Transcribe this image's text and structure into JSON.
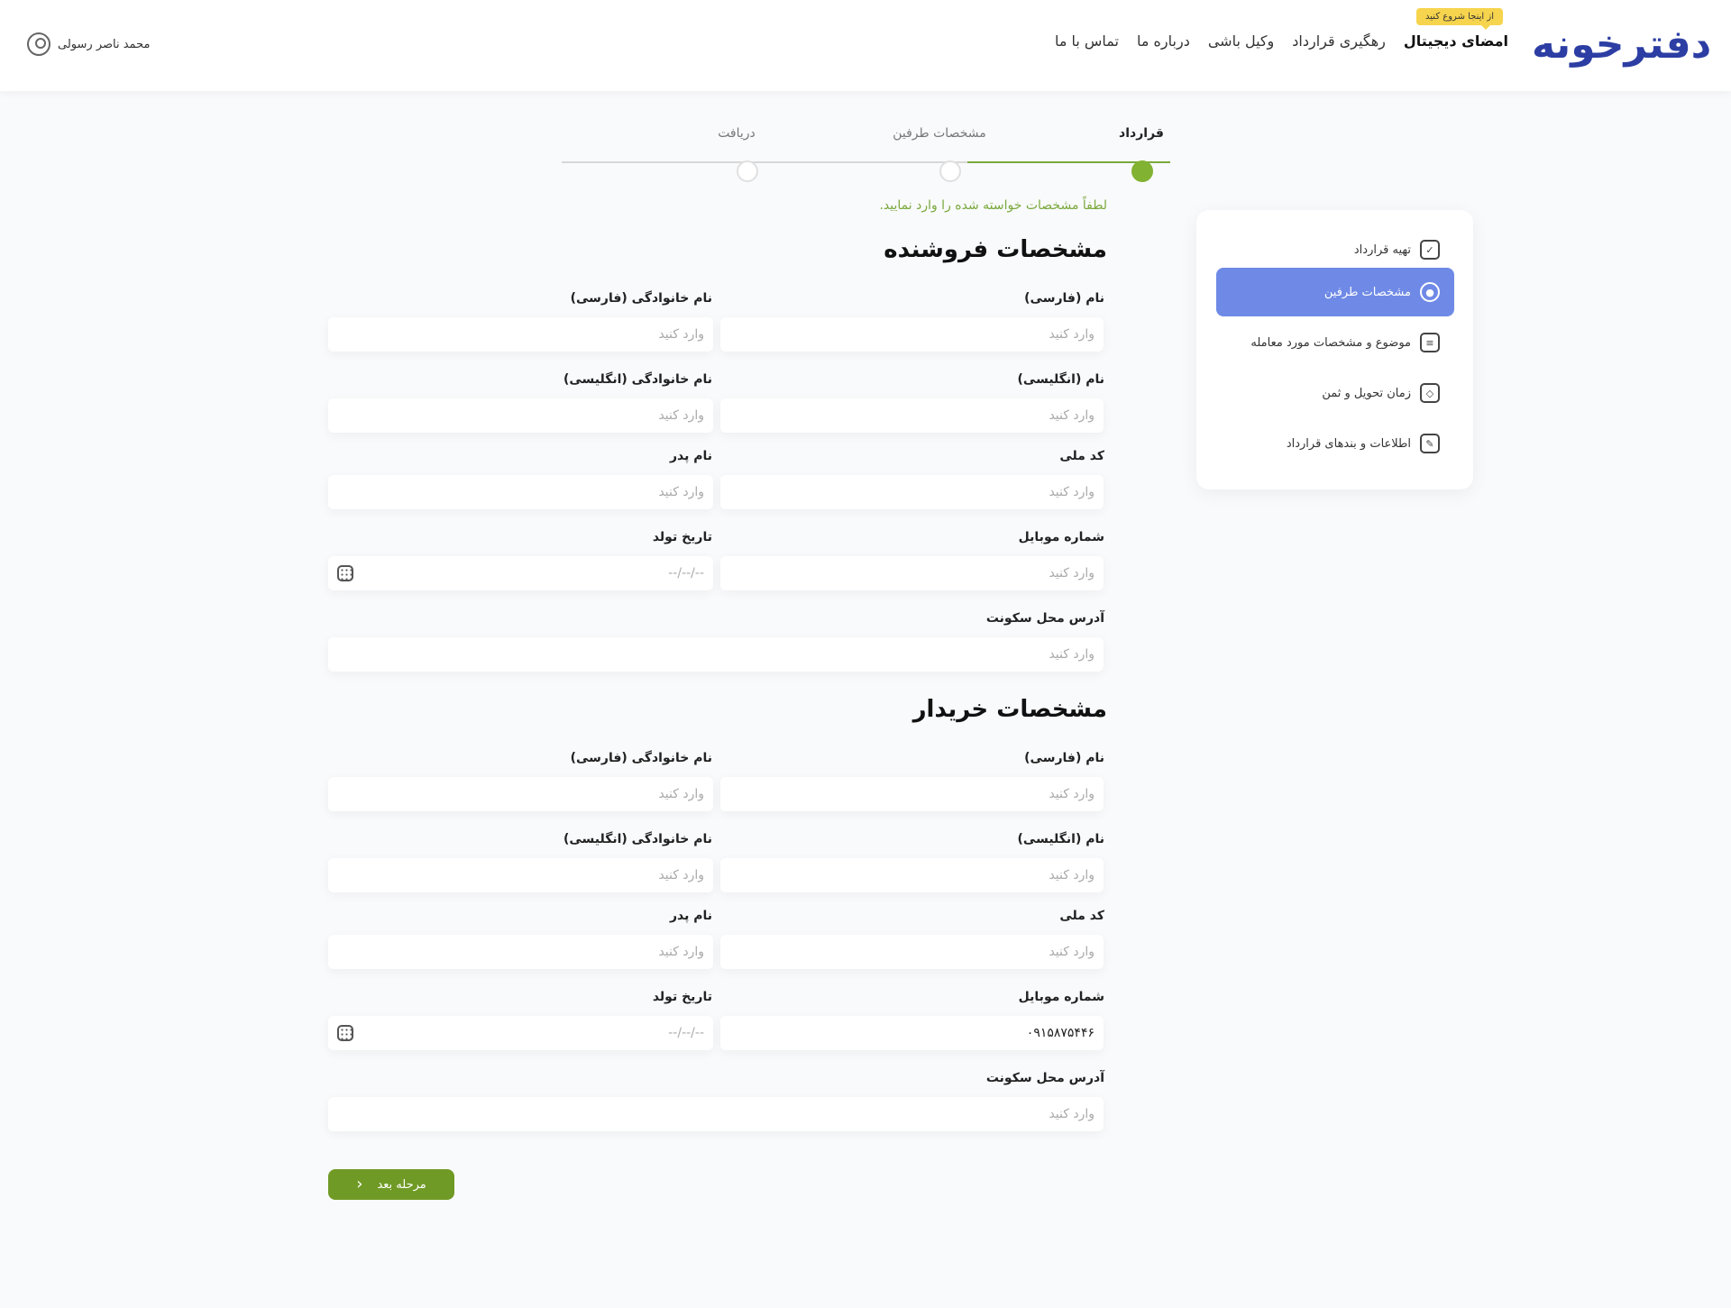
{
  "header": {
    "logo_text": "دفترخونه",
    "badge": "از اینجا شروع کنید",
    "nav": [
      "امضای دیجیتال",
      "رهگیری قرارداد",
      "وکیل باشی",
      "درباره ما",
      "تماس با ما"
    ],
    "user_name": "محمد ناصر رسولی"
  },
  "stepper": {
    "steps": [
      "قرارداد",
      "مشخصات طرفین",
      "دریافت"
    ],
    "current": 0
  },
  "sidebar": {
    "items": [
      {
        "label": "تهیه قرارداد",
        "icon": "contract-icon"
      },
      {
        "label": "مشخصات طرفین",
        "icon": "user-icon"
      },
      {
        "label": "موضوع و مشخصات مورد معامله",
        "icon": "document-icon"
      },
      {
        "label": "زمان تحویل و ثمن",
        "icon": "shield-icon"
      },
      {
        "label": "اطلاعات و بندهای قرارداد",
        "icon": "edit-icon"
      }
    ],
    "active": 1
  },
  "form": {
    "hint": "لطفاً مشخصات خواسته شده را وارد نمایید.",
    "placeholder": "وارد کنید",
    "date_placeholder": "--/--/--",
    "labels": {
      "first_fa": "نام (فارسی)",
      "last_fa": "نام خانوادگی (فارسی)",
      "first_en": "نام (انگلیسی)",
      "last_en": "نام خانوادگی (انگلیسی)",
      "national_code": "کد ملی",
      "father": "نام پدر",
      "mobile": "شماره موبایل",
      "birth": "تاریخ تولد",
      "address": "آدرس محل سکونت"
    },
    "seller": {
      "title": "مشخصات فروشنده",
      "mobile_value": ""
    },
    "buyer": {
      "title": "مشخصات خریدار",
      "mobile_value": "۰۹۱۵۸۷۵۴۴۶"
    },
    "next_label": "مرحله بعد"
  }
}
